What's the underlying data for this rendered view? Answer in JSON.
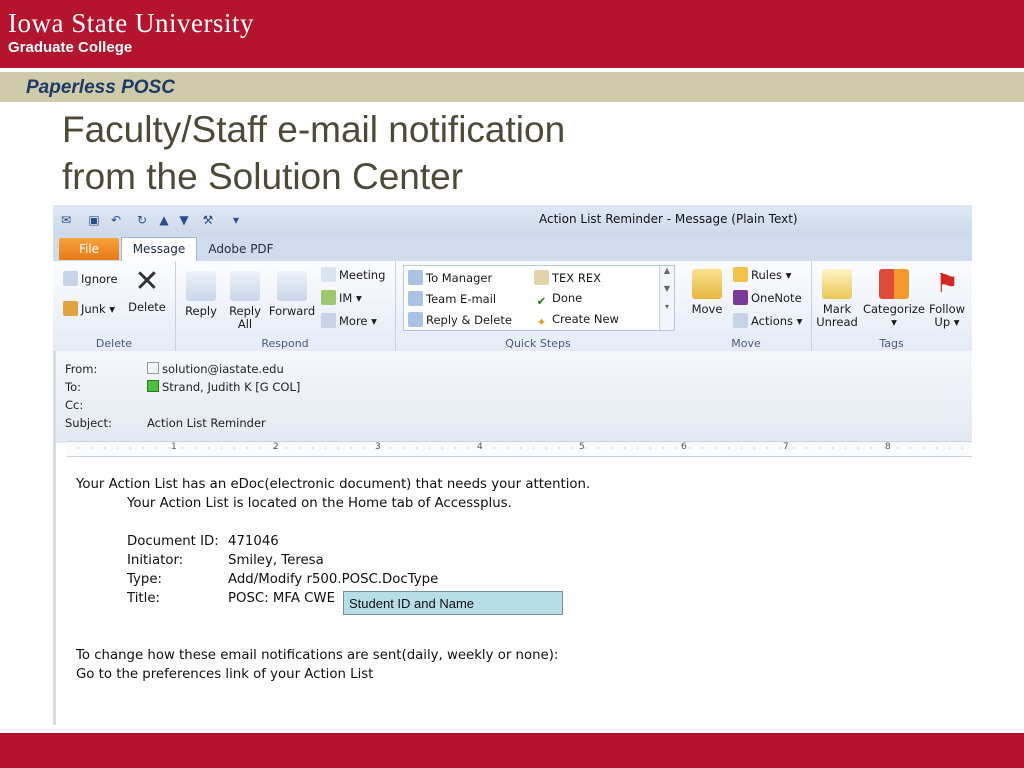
{
  "header": {
    "university": "Iowa State University",
    "college": "Graduate College",
    "section": "Paperless POSC",
    "title_line1": "Faculty/Staff e-mail notification",
    "title_line2": "from the Solution Center"
  },
  "window": {
    "title": "Action List Reminder  -  Message (Plain Text)"
  },
  "tabs": [
    "File",
    "Message",
    "Adobe PDF"
  ],
  "ribbon": {
    "delete_group": {
      "ignore": "Ignore",
      "junk": "Junk",
      "delete": "Delete",
      "label": "Delete"
    },
    "respond_group": {
      "reply": "Reply",
      "reply_all_1": "Reply",
      "reply_all_2": "All",
      "forward": "Forward",
      "meeting": "Meeting",
      "im": "IM",
      "more": "More",
      "label": "Respond"
    },
    "quicksteps_group": {
      "to_manager": "To Manager",
      "team_email": "Team E-mail",
      "reply_delete": "Reply & Delete",
      "tex_rex": "TEX REX",
      "done": "Done",
      "create_new": "Create New",
      "label": "Quick Steps"
    },
    "move_group": {
      "move": "Move",
      "rules": "Rules",
      "onenote": "OneNote",
      "actions": "Actions",
      "label": "Move"
    },
    "tags_group": {
      "mark_1": "Mark",
      "mark_2": "Unread",
      "categorize": "Categorize",
      "follow_1": "Follow",
      "follow_2": "Up",
      "label": "Tags"
    }
  },
  "message_header": {
    "from_label": "From:",
    "from_value": "solution@iastate.edu",
    "to_label": "To:",
    "to_value": "Strand, Judith K [G COL]",
    "cc_label": "Cc:",
    "subject_label": "Subject:",
    "subject_value": "Action List Reminder"
  },
  "ruler_marks": [
    "1",
    "2",
    "3",
    "4",
    "5",
    "6",
    "7",
    "8"
  ],
  "body": {
    "line1": "Your Action List has an eDoc(electronic document) that needs your attention.",
    "line2": "Your Action List is located on the Home tab of Accessplus.",
    "doc_id_label": "Document ID:",
    "doc_id_value": "471046",
    "initiator_label": "Initiator:",
    "initiator_value": "Smiley, Teresa",
    "type_label": "Type:",
    "type_value": "Add/Modify r500.POSC.DocType",
    "title_label": "Title:",
    "title_value": "POSC: MFA CWE",
    "pref_line1": "To change how these email notifications are sent(daily, weekly or none):",
    "pref_line2": "Go to the preferences link of your Action List"
  },
  "callout": "Student ID and Name",
  "colors": {
    "brand_red": "#b5142f",
    "band_tan": "#cfcbaa",
    "office_orange": "#e6791b"
  }
}
